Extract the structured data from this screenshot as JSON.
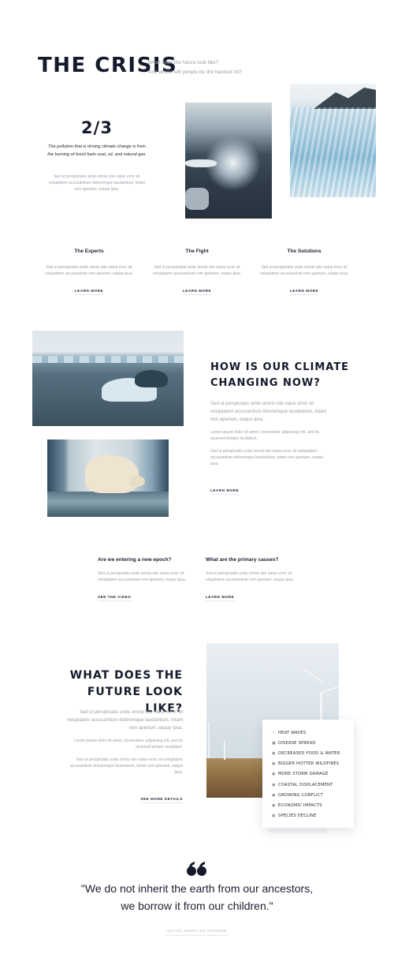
{
  "header": {
    "title": "THE CRISIS",
    "subtitle_line1": "What does the future look like?",
    "subtitle_line2": "And where will people be the hardest hit?"
  },
  "intro": {
    "counter": "2/3",
    "lead": "The pollution that is driving climate change is from the burning of fossil fuels coal, oil, and natural gas.",
    "body": "Sed ut perspiciatis unde omnis iste natus error sit voluptatem accusantium doloremque laudantium, totam rem aperiam, eaque ipsa."
  },
  "features": [
    {
      "title": "The Experts",
      "body": "Sed ut perspiciatis unde omnis iste natus error sit voluptatem accusantium rem aperiam, eaque ipsa.",
      "link": "LEARN MORE"
    },
    {
      "title": "The Fight",
      "body": "Sed ut perspiciatis unde omnis iste natus error sit voluptatem accusantium rem aperiam, eaque ipsa.",
      "link": "LEARN MORE"
    },
    {
      "title": "The Solutions",
      "body": "Sed ut perspiciatis unde omnis iste natus error sit voluptatem accusantium rem aperiam, eaque ipsa.",
      "link": "LEARN MORE"
    }
  ],
  "climate": {
    "heading_line1": "HOW IS OUR CLIMATE",
    "heading_line2": "CHANGING NOW?",
    "lead": "Sed ut perspiciatis unde omnis iste natus error sit voluptatem accusantium doloremque laudantium, totam rem aperiam, eaque ipsa.",
    "p1": "Lorem ipsum dolor sit amet, consectetur adipiscing elit, sed do eiusmod tempor incididunt.",
    "p2": "Sed ut perspiciatis unde omnis iste natus error sit voluptatem accusantium doloremque laudantium, totam rem aperiam, eaque ipsa.",
    "link": "LEARN MORE"
  },
  "questions": [
    {
      "title": "Are we entering a new epoch?",
      "body": "Sed ut perspiciatis unde omnis iste natus error sit voluptatem accusantium rem aperiam, eaque ipsa.",
      "link": "SEE THE VIDEO"
    },
    {
      "title": "What are the primary causes?",
      "body": "Sed ut perspiciatis unde omnis iste natus error sit voluptatem accusantium rem aperiam, eaque ipsa.",
      "link": "LEARN MORE"
    }
  ],
  "future": {
    "heading_line1": "WHAT DOES THE",
    "heading_line2": "FUTURE LOOK LIKE?",
    "lead": "Sed ut perspiciatis unde omnis iste natus error sit voluptatem accusantium doloremque laudantium, totam rem aperiam, eaque ipsa.",
    "p1": "Lorem ipsum dolor sit amet, consectetur adipiscing elit, sed do eiusmod tempor incididunt.",
    "p2": "Sed ut perspiciatis unde omnis iste natus error sit voluptatem accusantium doloremque laudantium, totam rem aperiam, eaque ipsa.",
    "link": "SEE MORE DETAILS",
    "impacts": [
      "HEAT WAVES",
      "DISEASE SPREAD",
      "DECREASED FOOD & WATER",
      "BIGGER HOTTER WILDFIRES",
      "MORE STORM DAMAGE",
      "COASTAL DISPLACEMENT",
      "GROWING CONFLICT",
      "ECONOMIC IMPACTS",
      "SPECIES DECLINE"
    ]
  },
  "quote": {
    "line1": "\"We do not inherit the earth from our ancestors,",
    "line2": "we borrow it from our children.\"",
    "attribution": "NATIVE AMERICAN PROVERB"
  },
  "icons": {
    "quote": "quote-icon",
    "check": "check-icon",
    "bullet": "bullet-icon"
  }
}
